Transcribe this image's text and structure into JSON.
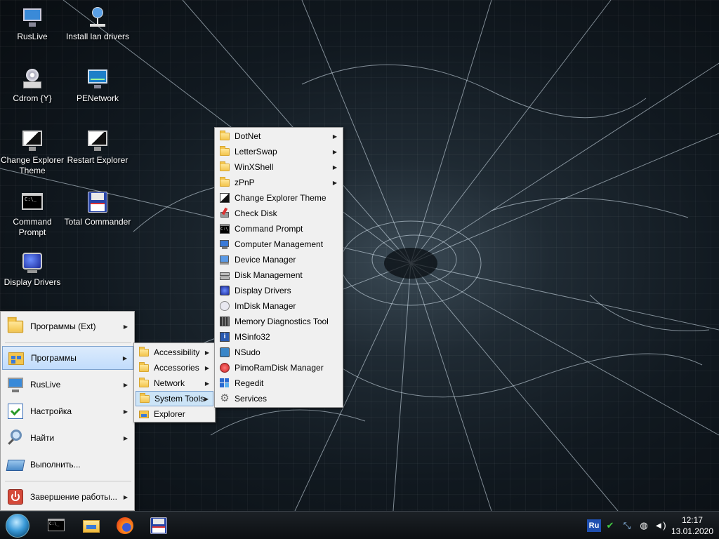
{
  "desktop": {
    "icons": [
      {
        "label": "RusLive",
        "icon": "monitor-icon"
      },
      {
        "label": "Install lan drivers",
        "icon": "network-install-icon"
      },
      {
        "label": "Cdrom {Y}",
        "icon": "cdrom-icon"
      },
      {
        "label": "PENetwork",
        "icon": "network-monitor-icon"
      },
      {
        "label": "Change Explorer Theme",
        "icon": "theme-monitor-icon"
      },
      {
        "label": "Restart Explorer",
        "icon": "restart-monitor-icon"
      },
      {
        "label": "Command Prompt",
        "icon": "cmd-icon"
      },
      {
        "label": "Total Commander",
        "icon": "floppy-icon"
      },
      {
        "label": "Display Drivers",
        "icon": "display-icon"
      }
    ]
  },
  "start_menu": {
    "items": [
      {
        "label": "Программы (Ext)",
        "icon": "folder-icon",
        "submenu": true
      },
      {
        "label": "Программы",
        "icon": "programs-icon",
        "submenu": true,
        "highlighted": true
      },
      {
        "label": "RusLive",
        "icon": "monitor-icon",
        "submenu": true
      },
      {
        "label": "Настройка",
        "icon": "settings-icon",
        "submenu": true
      },
      {
        "label": "Найти",
        "icon": "search-icon",
        "submenu": true
      },
      {
        "label": "Выполнить...",
        "icon": "run-icon",
        "submenu": false
      },
      {
        "label": "Завершение работы...",
        "icon": "power-icon",
        "submenu": true
      }
    ]
  },
  "programs_menu": {
    "items": [
      {
        "label": "Accessibility",
        "icon": "folder-icon",
        "submenu": true
      },
      {
        "label": "Accessories",
        "icon": "folder-icon",
        "submenu": true
      },
      {
        "label": "Network",
        "icon": "folder-icon",
        "submenu": true
      },
      {
        "label": "System Tools",
        "icon": "folder-icon",
        "submenu": true,
        "highlighted": true
      },
      {
        "label": "Explorer",
        "icon": "explorer-icon",
        "submenu": false
      }
    ]
  },
  "system_tools_menu": {
    "items": [
      {
        "label": "DotNet",
        "icon": "folder-icon",
        "submenu": true
      },
      {
        "label": "LetterSwap",
        "icon": "folder-icon",
        "submenu": true
      },
      {
        "label": "WinXShell",
        "icon": "folder-icon",
        "submenu": true
      },
      {
        "label": "zPnP",
        "icon": "folder-icon",
        "submenu": true
      },
      {
        "label": "Change Explorer Theme",
        "icon": "theme-icon"
      },
      {
        "label": "Check Disk",
        "icon": "check-disk-icon"
      },
      {
        "label": "Command Prompt",
        "icon": "cmd-icon"
      },
      {
        "label": "Computer Management",
        "icon": "computer-management-icon"
      },
      {
        "label": "Device Manager",
        "icon": "device-manager-icon"
      },
      {
        "label": "Disk Management",
        "icon": "disk-management-icon"
      },
      {
        "label": "Display Drivers",
        "icon": "display-icon"
      },
      {
        "label": "ImDisk Manager",
        "icon": "imdisk-icon"
      },
      {
        "label": "Memory Diagnostics Tool",
        "icon": "memory-icon"
      },
      {
        "label": "MSinfo32",
        "icon": "info-icon"
      },
      {
        "label": "NSudo",
        "icon": "nsudo-icon"
      },
      {
        "label": "PimoRamDisk Manager",
        "icon": "ramdisk-icon"
      },
      {
        "label": "Regedit",
        "icon": "regedit-icon"
      },
      {
        "label": "Services",
        "icon": "gear-icon"
      }
    ]
  },
  "taskbar": {
    "pinned": [
      "cmd-icon",
      "folder-icon",
      "firefox-icon",
      "floppy-icon"
    ],
    "tray": {
      "language": "Ru",
      "icons": [
        "usb-safe-remove-icon",
        "network-tool-icon",
        "globe-icon",
        "volume-icon"
      ]
    },
    "time": "12:17",
    "date": "13.01.2020"
  }
}
